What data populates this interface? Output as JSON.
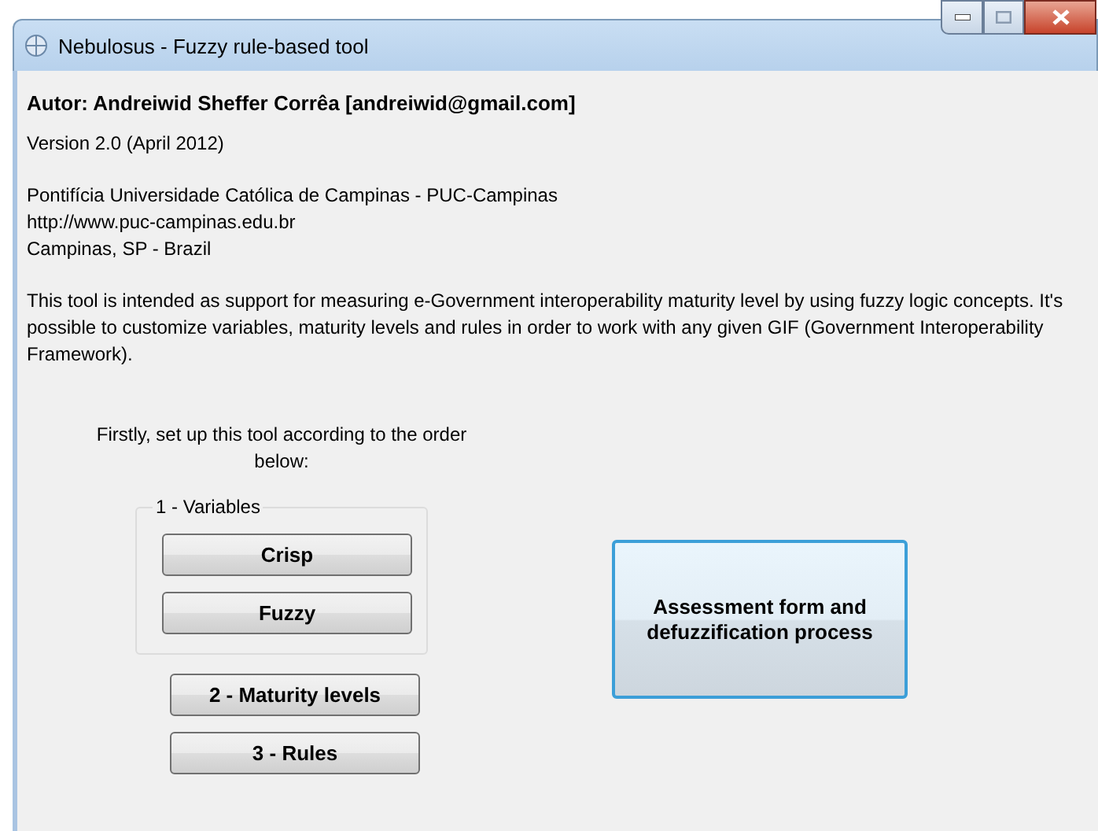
{
  "window": {
    "title": "Nebulosus - Fuzzy rule-based tool"
  },
  "author": "Autor: Andreiwid Sheffer Corrêa [andreiwid@gmail.com]",
  "version": "Version 2.0 (April 2012)",
  "institution": [
    "Pontifícia Universidade Católica de Campinas - PUC-Campinas",
    "http://www.puc-campinas.edu.br",
    "Campinas, SP - Brazil"
  ],
  "description": "This tool is intended as support for measuring e-Government interoperability maturity level by using fuzzy logic concepts. It's possible to customize variables, maturity levels and rules in order to work with any given GIF (Government Interoperability Framework).",
  "instruction": "Firstly, set up this tool according to the order below:",
  "variables_group": {
    "label": "1 - Variables",
    "buttons": [
      "Crisp",
      "Fuzzy"
    ]
  },
  "setup_buttons": [
    "2 - Maturity levels",
    "3 - Rules"
  ],
  "assessment_button": {
    "label": "Assessment form and defuzzification process",
    "focused": true
  }
}
